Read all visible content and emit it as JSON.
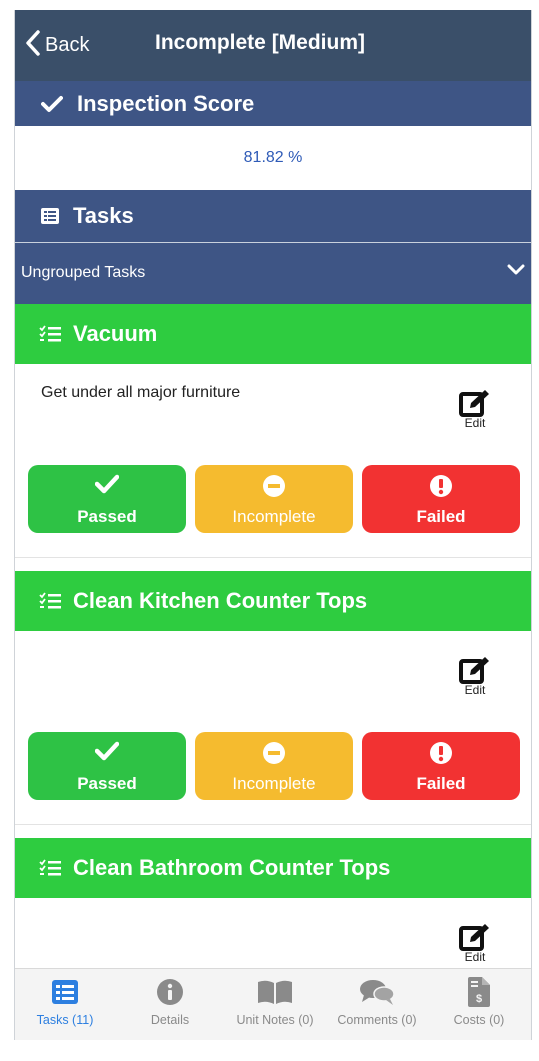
{
  "navbar": {
    "back_label": "Back",
    "title": "Incomplete [Medium]"
  },
  "score": {
    "heading": "Inspection Score",
    "value": "81.82 %"
  },
  "tasks_section": {
    "heading": "Tasks",
    "group_label": "Ungrouped Tasks"
  },
  "tasks": [
    {
      "title": "Vacuum",
      "description": "Get under all major furniture",
      "edit_label": "Edit",
      "passed_label": "Passed",
      "incomplete_label": "Incomplete",
      "failed_label": "Failed"
    },
    {
      "title": "Clean Kitchen Counter Tops",
      "description": "",
      "edit_label": "Edit",
      "passed_label": "Passed",
      "incomplete_label": "Incomplete",
      "failed_label": "Failed"
    },
    {
      "title": "Clean Bathroom Counter Tops",
      "description": "",
      "edit_label": "Edit"
    }
  ],
  "tabbar": [
    {
      "label": "Tasks (11)",
      "icon": "list-icon",
      "active": true
    },
    {
      "label": "Details",
      "icon": "info-icon",
      "active": false
    },
    {
      "label": "Unit Notes (0)",
      "icon": "book-icon",
      "active": false
    },
    {
      "label": "Comments (0)",
      "icon": "comments-icon",
      "active": false
    },
    {
      "label": "Costs (0)",
      "icon": "invoice-icon",
      "active": false
    }
  ],
  "colors": {
    "navbar": "#3a4f69",
    "section": "#3e5585",
    "task_header": "#2ecc40",
    "passed": "#2ec245",
    "incomplete": "#f5bb2f",
    "failed": "#f23232",
    "score_text": "#2f5bb7",
    "tab_active": "#2d7fe0"
  }
}
